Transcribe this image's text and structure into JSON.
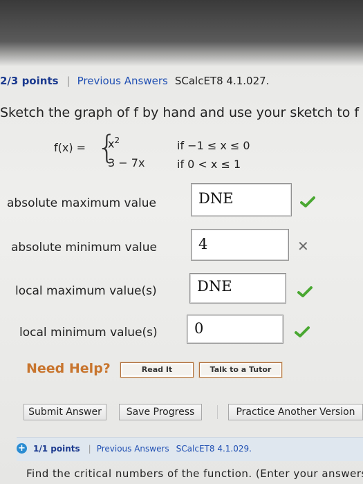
{
  "header": {
    "points": "2/3 points",
    "separator": "|",
    "previous_answers": "Previous Answers",
    "problem_code": "SCalcET8 4.1.027."
  },
  "instruction": "Sketch the graph of f by hand and use your sketch to f",
  "function": {
    "lhs": "f(x) =",
    "case1_expr": "x2",
    "case1_cond": "if −1 ≤ x ≤ 0",
    "case2_expr": "3 − 7x",
    "case2_cond": "if 0 < x ≤ 1"
  },
  "answers": [
    {
      "label": "absolute maximum value",
      "value": "DNE",
      "status": "correct"
    },
    {
      "label": "absolute minimum value",
      "value": "4",
      "status": "incorrect"
    },
    {
      "label": "local maximum value(s)",
      "value": "DNE",
      "status": "correct"
    },
    {
      "label": "local minimum value(s)",
      "value": "0",
      "status": "correct"
    }
  ],
  "help": {
    "label": "Need Help?",
    "read_it": "Read It",
    "talk_to_tutor": "Talk to a Tutor"
  },
  "actions": {
    "submit": "Submit Answer",
    "save": "Save Progress",
    "practice": "Practice Another Version"
  },
  "next_question": {
    "points": "1/1 points",
    "separator": "|",
    "previous_answers": "Previous Answers",
    "problem_code": "SCalcET8 4.1.029.",
    "text": "Find the critical numbers of the function. (Enter your answers"
  },
  "colors": {
    "correct_check": "#4aa832",
    "incorrect_cross": "#6a6a6a",
    "link_blue": "#1f4fb3",
    "help_orange": "#c8752e"
  }
}
